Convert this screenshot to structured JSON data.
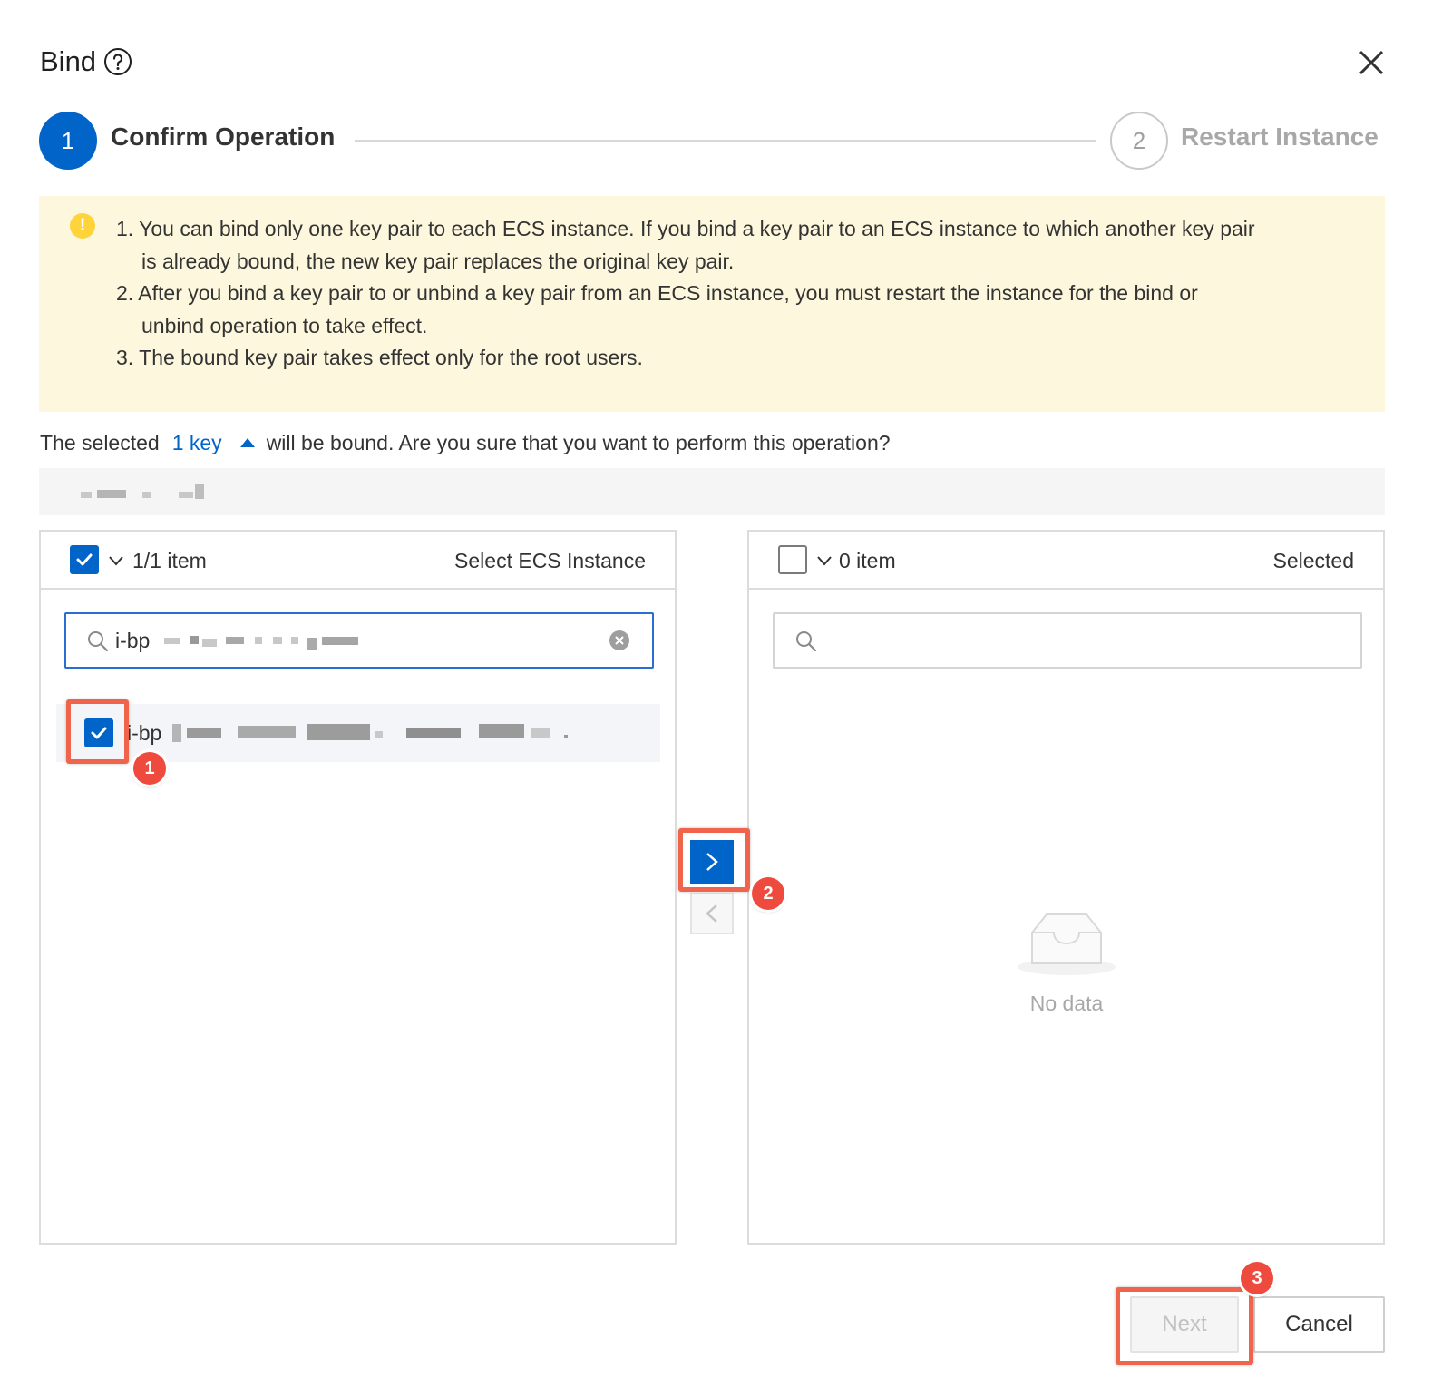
{
  "dialog": {
    "title": "Bind",
    "help_icon": "help-circle-icon",
    "close_icon": "close-icon"
  },
  "steps": [
    {
      "number": "1",
      "label": "Confirm Operation",
      "state": "active"
    },
    {
      "number": "2",
      "label": "Restart Instance",
      "state": "pending"
    }
  ],
  "alert": {
    "icon": "warning-icon",
    "lines": [
      "1. You can bind only one key pair to each ECS instance. If you bind a key pair to an ECS instance to which another key pair",
      "is already bound, the new key pair replaces the original key pair.",
      "2. After you bind a key pair to or unbind a key pair from an ECS instance, you must restart the instance for the bind or",
      "unbind operation to take effect.",
      "3. The bound key pair takes effect only for the root users."
    ]
  },
  "confirm": {
    "prefix": "The selected",
    "key_link": "1 key",
    "suffix": "will be bound. Are you sure that you want to perform this operation?"
  },
  "transfer": {
    "source": {
      "count": "1/1 item",
      "title": "Select ECS Instance",
      "search_value": "i-bp",
      "items": [
        {
          "label": "i-bp",
          "checked": true
        }
      ]
    },
    "target": {
      "count": "0 item",
      "title": "Selected",
      "search_placeholder": "",
      "empty_text": "No data"
    }
  },
  "annotations": [
    "1",
    "2",
    "3"
  ],
  "buttons": {
    "next": "Next",
    "cancel": "Cancel"
  },
  "colors": {
    "primary": "#0064c8",
    "alert_background": "#fdf7dd",
    "annotation": "#ee4a3d"
  }
}
